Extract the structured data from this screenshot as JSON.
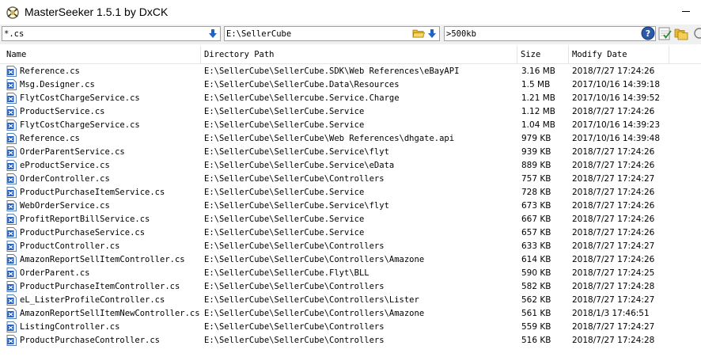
{
  "window": {
    "title": "MasterSeeker 1.5.1 by DxCK"
  },
  "search": {
    "filename_value": "*.cs",
    "path_value": "E:\\SellerCube",
    "size_value": ">500kb"
  },
  "columns": {
    "name": "Name",
    "path": "Directory Path",
    "size": "Size",
    "date": "Modify Date"
  },
  "rows": [
    {
      "name": "Reference.cs",
      "path": "E:\\SellerCube\\SellerCube.SDK\\Web References\\eBayAPI",
      "size": "3.16 MB",
      "date": "2018/7/27 17:24:26"
    },
    {
      "name": "Msg.Designer.cs",
      "path": "E:\\SellerCube\\SellerCube.Data\\Resources",
      "size": "1.5 MB",
      "date": "2017/10/16 14:39:18"
    },
    {
      "name": "FlytCostChargeService.cs",
      "path": "E:\\SellerCube\\Sellercube.Service.Charge",
      "size": "1.21 MB",
      "date": "2017/10/16 14:39:52"
    },
    {
      "name": "ProductService.cs",
      "path": "E:\\SellerCube\\SellerCube.Service",
      "size": "1.12 MB",
      "date": "2018/7/27 17:24:26"
    },
    {
      "name": "FlytCostChargeService.cs",
      "path": "E:\\SellerCube\\SellerCube.Service",
      "size": "1.04 MB",
      "date": "2017/10/16 14:39:23"
    },
    {
      "name": "Reference.cs",
      "path": "E:\\SellerCube\\SellerCube\\Web References\\dhgate.api",
      "size": "979 KB",
      "date": "2017/10/16 14:39:48"
    },
    {
      "name": "OrderParentService.cs",
      "path": "E:\\SellerCube\\SellerCube.Service\\flyt",
      "size": "939 KB",
      "date": "2018/7/27 17:24:26"
    },
    {
      "name": "eProductService.cs",
      "path": "E:\\SellerCube\\SellerCube.Service\\eData",
      "size": "889 KB",
      "date": "2018/7/27 17:24:26"
    },
    {
      "name": "OrderController.cs",
      "path": "E:\\SellerCube\\SellerCube\\Controllers",
      "size": "757 KB",
      "date": "2018/7/27 17:24:27"
    },
    {
      "name": "ProductPurchaseItemService.cs",
      "path": "E:\\SellerCube\\SellerCube.Service",
      "size": "728 KB",
      "date": "2018/7/27 17:24:26"
    },
    {
      "name": "WebOrderService.cs",
      "path": "E:\\SellerCube\\SellerCube.Service\\flyt",
      "size": "673 KB",
      "date": "2018/7/27 17:24:26"
    },
    {
      "name": "ProfitReportBillService.cs",
      "path": "E:\\SellerCube\\SellerCube.Service",
      "size": "667 KB",
      "date": "2018/7/27 17:24:26"
    },
    {
      "name": "ProductPurchaseService.cs",
      "path": "E:\\SellerCube\\SellerCube.Service",
      "size": "657 KB",
      "date": "2018/7/27 17:24:26"
    },
    {
      "name": "ProductController.cs",
      "path": "E:\\SellerCube\\SellerCube\\Controllers",
      "size": "633 KB",
      "date": "2018/7/27 17:24:27"
    },
    {
      "name": "AmazonReportSellItemController.cs",
      "path": "E:\\SellerCube\\SellerCube\\Controllers\\Amazone",
      "size": "614 KB",
      "date": "2018/7/27 17:24:26"
    },
    {
      "name": "OrderParent.cs",
      "path": "E:\\SellerCube\\SellerCube.Flyt\\BLL",
      "size": "590 KB",
      "date": "2018/7/27 17:24:25"
    },
    {
      "name": "ProductPurchaseItemController.cs",
      "path": "E:\\SellerCube\\SellerCube\\Controllers",
      "size": "582 KB",
      "date": "2018/7/27 17:24:28"
    },
    {
      "name": "eL_ListerProfileController.cs",
      "path": "E:\\SellerCube\\SellerCube\\Controllers\\Lister",
      "size": "562 KB",
      "date": "2018/7/27 17:24:27"
    },
    {
      "name": "AmazonReportSellItemNewController.cs",
      "path": "E:\\SellerCube\\SellerCube\\Controllers\\Amazone",
      "size": "561 KB",
      "date": "2018/1/3 17:46:51"
    },
    {
      "name": "ListingController.cs",
      "path": "E:\\SellerCube\\SellerCube\\Controllers",
      "size": "559 KB",
      "date": "2018/7/27 17:24:27"
    },
    {
      "name": "ProductPurchaseController.cs",
      "path": "E:\\SellerCube\\SellerCube\\Controllers",
      "size": "516 KB",
      "date": "2018/7/27 17:24:28"
    }
  ],
  "icons": {
    "app": "masterseeker-app-icon",
    "file": "csharp-file-icon",
    "dropdown": "blue-down-arrow-icon",
    "folder": "folder-open-icon",
    "help": "help-icon",
    "checklist": "checklist-icon",
    "folders": "folders-icon"
  },
  "colors": {
    "accent_blue": "#1e63c8",
    "folder_yellow": "#e8b830",
    "help_blue": "#2a5aa8",
    "toolbar_bg": "#f0f0f0"
  }
}
